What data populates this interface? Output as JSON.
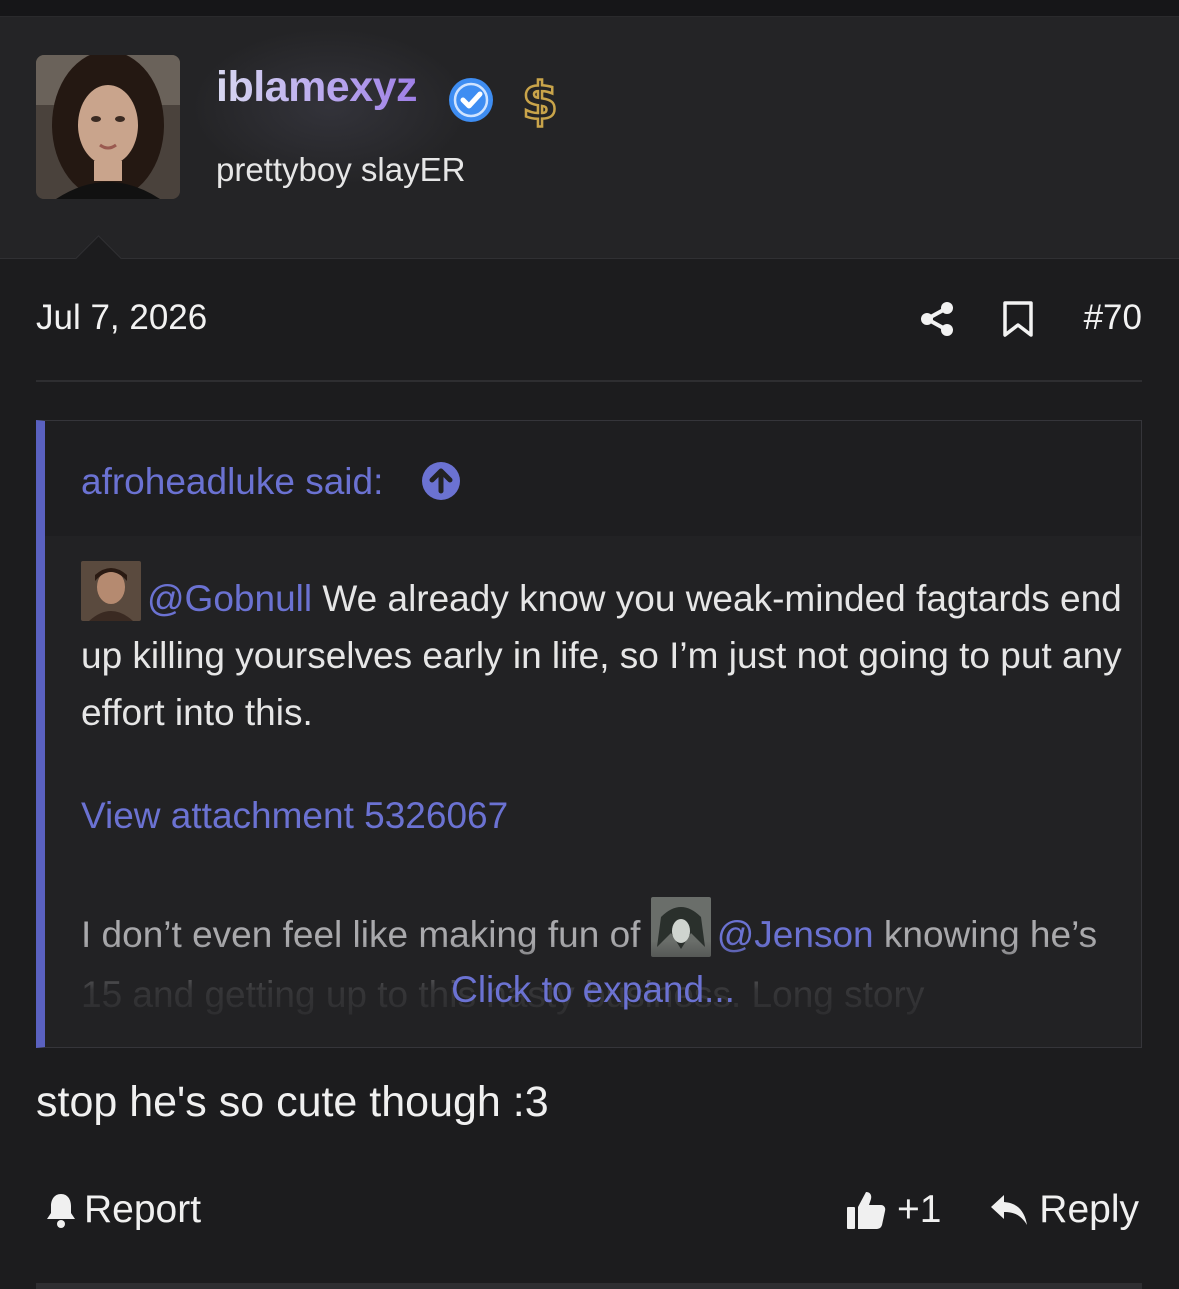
{
  "user": {
    "username": "iblamexyz",
    "title": "prettyboy slayER",
    "badges": [
      "verified-icon",
      "dollar-icon"
    ]
  },
  "post": {
    "date": "Jul 7, 2026",
    "number": "#70",
    "message": "stop he's so cute though :3"
  },
  "quote": {
    "author": "afroheadluke said:",
    "line1_mention": "@Gobnull",
    "line1_text": " We already know you weak-minded fagtards end up killing yourselves early in life, so I’m just not going to put any effort into this.",
    "attachment": "View attachment 5326067",
    "line2_text": "I don’t even feel like making fun of ",
    "line2_mention": "@Jenson",
    "line2_rest": " knowing he’s 15 and getting up to this nasty business. Long story",
    "expand": "Click to expand..."
  },
  "actions": {
    "report": "Report",
    "like": "+1",
    "reply": "Reply"
  },
  "colors": {
    "accent": "#6b72d2",
    "quote_bar": "#5a61c0",
    "background": "#1c1c1e"
  }
}
